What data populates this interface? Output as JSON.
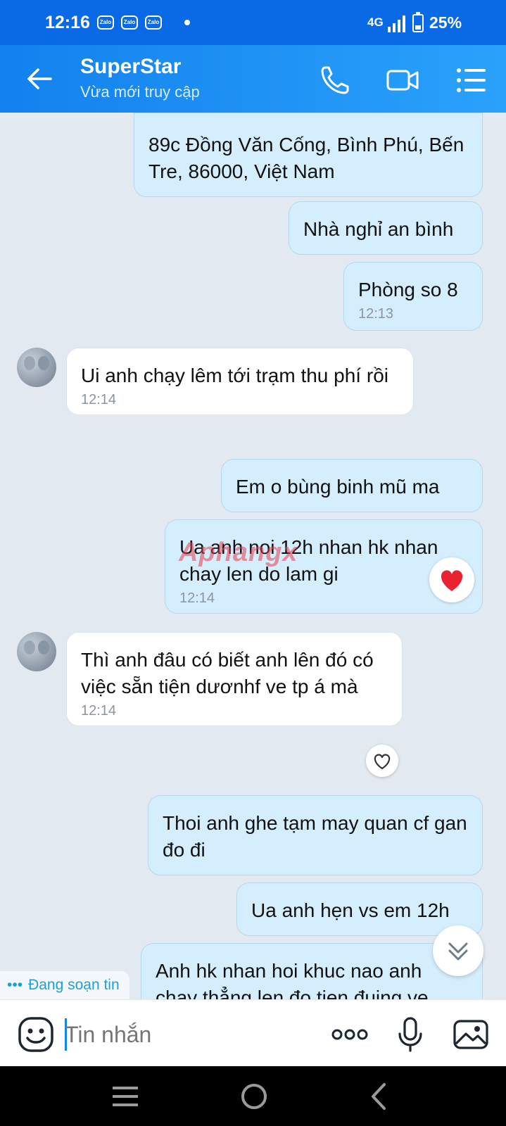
{
  "status_bar": {
    "time": "12:16",
    "app_icons": [
      "Zalo",
      "Zalo",
      "Zalo"
    ],
    "network": "4G",
    "battery": "25%"
  },
  "header": {
    "name": "SuperStar",
    "status": "Vừa mới truy cập",
    "accent_color": "#1a8cf0"
  },
  "messages": [
    {
      "side": "me",
      "text": "89c Đồng Văn Cống, Bình Phú, Bến Tre, 86000, Việt Nam"
    },
    {
      "side": "me",
      "text": "Nhà nghỉ an bình"
    },
    {
      "side": "me",
      "text": "Phòng so 8",
      "time": "12:13"
    },
    {
      "side": "them",
      "text": "Ui anh chạy lêm tới trạm thu phí rồi",
      "time": "12:14"
    },
    {
      "side": "me",
      "text": "Em o bùng binh mũ ma"
    },
    {
      "side": "me",
      "text": "Ua anh noi 12h nhan hk nhan chay len do lam gi",
      "time": "12:14",
      "reaction": "heart"
    },
    {
      "side": "them",
      "text": "Thì anh đâu có biết anh lên đó có việc sẵn tiện dươnhf ve tp á mà",
      "time": "12:14"
    },
    {
      "side": "me",
      "text": "Thoi anh ghe tạm may quan cf gan đo đi"
    },
    {
      "side": "me",
      "text": "Ua anh hẹn vs em 12h"
    },
    {
      "side": "me",
      "text": "Anh hk nhan hoi khuc nao anh chay thẳng len đo tien đuing ve"
    }
  ],
  "watermark": "Aphangx",
  "typing_indicator": "Đang soạn tin",
  "input": {
    "placeholder": "Tin nhắn"
  }
}
